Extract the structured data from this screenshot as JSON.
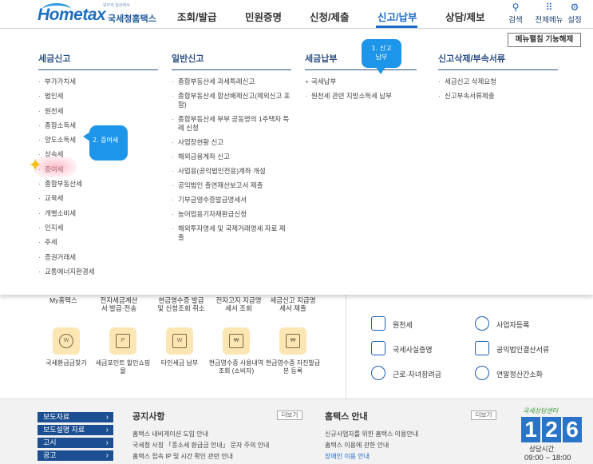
{
  "header": {
    "logo_slogan": "모두의 일상에서",
    "logo_text": "Hometax",
    "logo_sub": "국세청홈택스",
    "nav": [
      "조회/발급",
      "민원증명",
      "신청/제출",
      "신고/납부",
      "상담/제보"
    ],
    "active_nav": "신고/납부",
    "utils": [
      {
        "label": "검색",
        "icon": "search-icon"
      },
      {
        "label": "전체메뉴",
        "icon": "grid-icon"
      },
      {
        "label": "설정",
        "icon": "gear-icon"
      }
    ]
  },
  "menu": {
    "collapse_label": "메뉴펼침 기능해제",
    "columns": [
      {
        "title": "세금신고",
        "items": [
          "부가가치세",
          "법인세",
          "원천세",
          "종합소득세",
          "양도소득세",
          "상속세",
          "증여세",
          "종합부동산세",
          "교육세",
          "개별소비세",
          "인지세",
          "주세",
          "증권거래세",
          "교통에너지환경세"
        ]
      },
      {
        "title": "일반신고",
        "items": [
          "종합부동산세 과세특례신고",
          "종합부동산세 합산배제신고(제외신고 포함)",
          "종합부동산세 부부 공동명의 1주택자 특례 신청",
          "사업장현황 신고",
          "해외금융계좌 신고",
          "사업용(공익법인전용)계좌 개설",
          "공익법인 출연재산보고서 제출",
          "기부금영수증발급명세서",
          "농어업용기자재환급신청",
          "해외투자명세 및 국제거래명세 자료 제출"
        ]
      },
      {
        "title": "세금납부",
        "items": [
          "국세납부",
          "원천세 관련 지방소득세 납부"
        ]
      },
      {
        "title": "신고삭제/부속서류",
        "items": [
          "세금신고 삭제요청",
          "신고부속서류제출"
        ]
      }
    ],
    "callout_1": [
      "1. 신고",
      "납부"
    ],
    "callout_2": "2. 증여세"
  },
  "lower": {
    "cut_labels": [
      "My홈택스",
      "전자세금계산서 발급·전송",
      "현금영수증 발급 및 신청조회 취소",
      "전자고지 지급명세서 조회",
      "세금신고 지급명세서 제출"
    ],
    "services": [
      {
        "label": "국세환급금찾기",
        "icon": "refund-icon"
      },
      {
        "label": "세금포인트 할인쇼핑몰",
        "icon": "point-icon"
      },
      {
        "label": "타인세금 납부",
        "icon": "tax-payment-icon"
      },
      {
        "label": "현금영수증 사용내역조회 (소비자)",
        "icon": "receipt-icon"
      },
      {
        "label": "현금영수증 자진발급분 등록",
        "icon": "receipt-register-icon"
      }
    ],
    "right_links": [
      {
        "label": "원천세",
        "icon": "document-icon"
      },
      {
        "label": "사업자등록",
        "icon": "person-icon"
      },
      {
        "label": "국세사실증명",
        "icon": "certificate-icon"
      },
      {
        "label": "공익법인결산서류",
        "icon": "clipboard-icon"
      },
      {
        "label": "근로·자녀장려금",
        "icon": "heart-icon"
      },
      {
        "label": "연말정산간소화",
        "icon": "won-icon"
      }
    ]
  },
  "footer": {
    "buttons": [
      "보도자료",
      "보도설명 자료",
      "고시",
      "공고"
    ],
    "notice": {
      "title": "공지사항",
      "more": "더보기",
      "items": [
        "홈택스 내비게이션 도입 안내",
        "국세청 사칭 「종소세 환급금 안내」 문자 주의 안내",
        "홈택스 접속 IP 및 시간 확인 관련 안내"
      ]
    },
    "guide": {
      "title": "홈택스 안내",
      "more": "더보기",
      "items": [
        "신규사업자를 위한 홈택스 이용안내",
        "홈택스 이용에 관한 안내",
        "장애인 이용 안내"
      ]
    },
    "center_tag": "국세상담센터",
    "center_number": [
      "1",
      "2",
      "6"
    ],
    "hours_label": "상담시간",
    "hours": "09:00 ~ 18:00"
  }
}
